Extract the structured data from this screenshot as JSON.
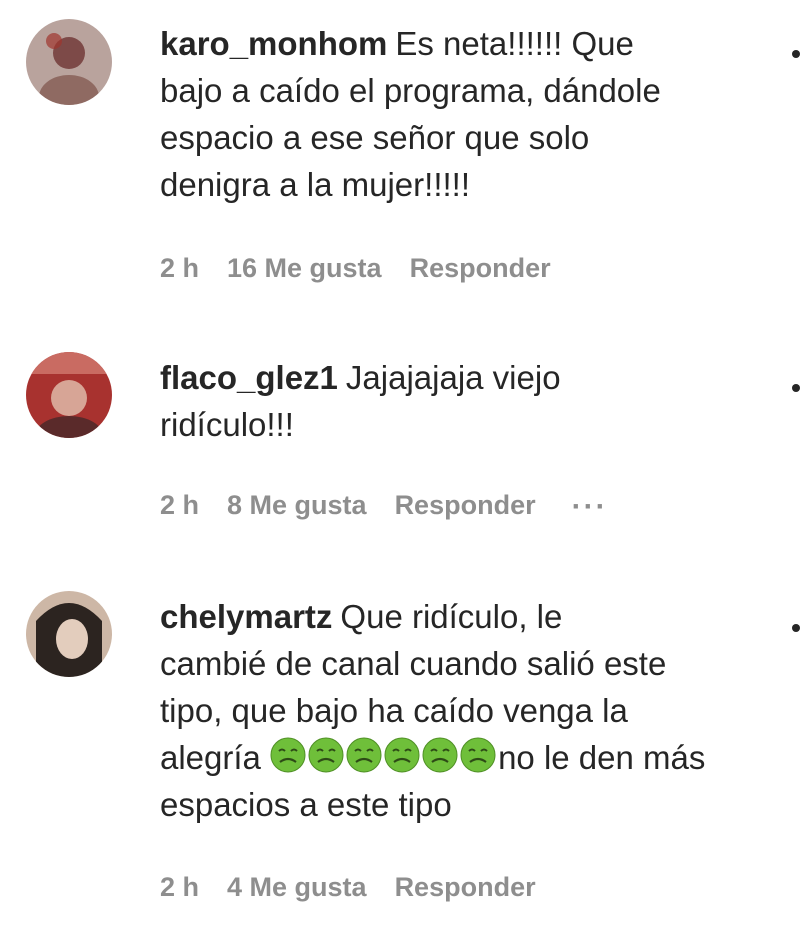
{
  "comments": [
    {
      "username": "karo_monhom",
      "lines": [
        "Es neta!!!!!! Que",
        "bajo a caído el programa, dándole",
        "espacio a ese señor que solo",
        "denigra a la mujer!!!!!"
      ],
      "time": "2 h",
      "likes": "16 Me gusta",
      "reply": "Responder",
      "avatar_colors": [
        "#8a5e5a",
        "#c8b0a8"
      ]
    },
    {
      "username": "flaco_glez1",
      "lines": [
        "Jajajajaja viejo",
        "ridículo!!!"
      ],
      "time": "2 h",
      "likes": "8 Me gusta",
      "reply": "Responder",
      "more": "···",
      "avatar_colors": [
        "#8e2f2f",
        "#d9a79b"
      ]
    },
    {
      "username": "chelymartz",
      "lines": [
        "Que ridículo, le",
        "cambié de canal cuando salió este",
        "tipo, que bajo ha caído venga la",
        "no le den más",
        "espacios a este tipo"
      ],
      "emoji_prefix": "alegría",
      "emoji_name": "nauseated-face",
      "emoji_count": 6,
      "time": "2 h",
      "likes": "4 Me gusta",
      "reply": "Responder",
      "avatar_colors": [
        "#3a2f28",
        "#d7c2b2"
      ]
    }
  ],
  "colors": {
    "text": "#262626",
    "meta": "#8e8e8e",
    "emoji_green": "#6fbf3a"
  }
}
